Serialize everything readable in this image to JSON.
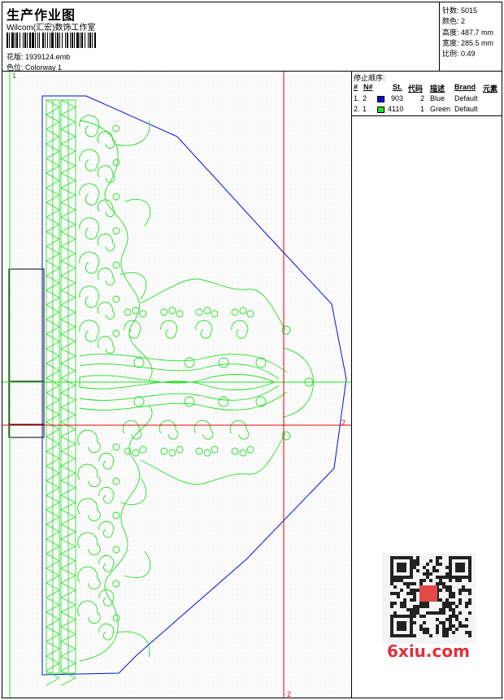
{
  "header": {
    "title": "生产作业图",
    "studio": "Wilcom(汇宏)数饰工作室",
    "design_label": "花版:",
    "design_value": "1939124.emb",
    "colorway_label": "色位:",
    "colorway_value": "Colorway 1"
  },
  "stats": [
    {
      "label": "针数",
      "value": "5015"
    },
    {
      "label": "颜色",
      "value": "2"
    },
    {
      "label": "高度",
      "value": "487.7 mm"
    },
    {
      "label": "宽度",
      "value": "285.5 mm"
    },
    {
      "label": "比例",
      "value": "0.49"
    }
  ],
  "canvas": {
    "guide_label_top": "1",
    "guide_label_right": "2",
    "guide_label_bottom": "2"
  },
  "stop_sequence": {
    "title": "停止顺序:",
    "headers": {
      "num": "#",
      "n": "N#",
      "st": "St.",
      "code": "代码",
      "desc": "描述",
      "brand": "Brand",
      "elem": "元素"
    },
    "rows": [
      {
        "num": "1.",
        "n": "2",
        "color": "#0010e0",
        "st": "903",
        "code": "2",
        "desc": "Blue",
        "brand": "Default"
      },
      {
        "num": "2.",
        "n": "1",
        "color": "#20e020",
        "st": "4110",
        "code": "1",
        "desc": "Green",
        "brand": "Default"
      }
    ]
  },
  "watermark": {
    "text": "6xiu.com"
  }
}
